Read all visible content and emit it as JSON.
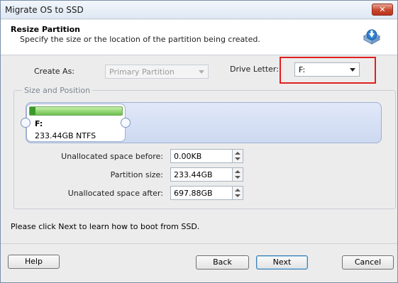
{
  "window": {
    "title": "Migrate OS to SSD",
    "close_label": "✕"
  },
  "header": {
    "title": "Resize Partition",
    "subtitle": "Specify the size or the location of the partition being created.",
    "icon": "disk-download-icon"
  },
  "create_as": {
    "label": "Create As:",
    "value": "Primary Partition",
    "enabled": false
  },
  "drive_letter": {
    "label": "Drive Letter:",
    "value": "F:"
  },
  "size_position": {
    "group_label": "Size and Position",
    "partition": {
      "letter": "F:",
      "info": "233.44GB NTFS"
    }
  },
  "fields": {
    "unalloc_before": {
      "label": "Unallocated space before:",
      "value": "0.00KB"
    },
    "partition_size": {
      "label": "Partition size:",
      "value": "233.44GB"
    },
    "unalloc_after": {
      "label": "Unallocated space after:",
      "value": "697.88GB"
    }
  },
  "hint": "Please click Next to learn how to boot from SSD.",
  "buttons": {
    "help": "Help",
    "back": "Back",
    "next": "Next",
    "cancel": "Cancel"
  },
  "colors": {
    "highlight": "#e02020",
    "partition_fill": "#8ed46f",
    "disk_bar": "#cdd9f1"
  }
}
